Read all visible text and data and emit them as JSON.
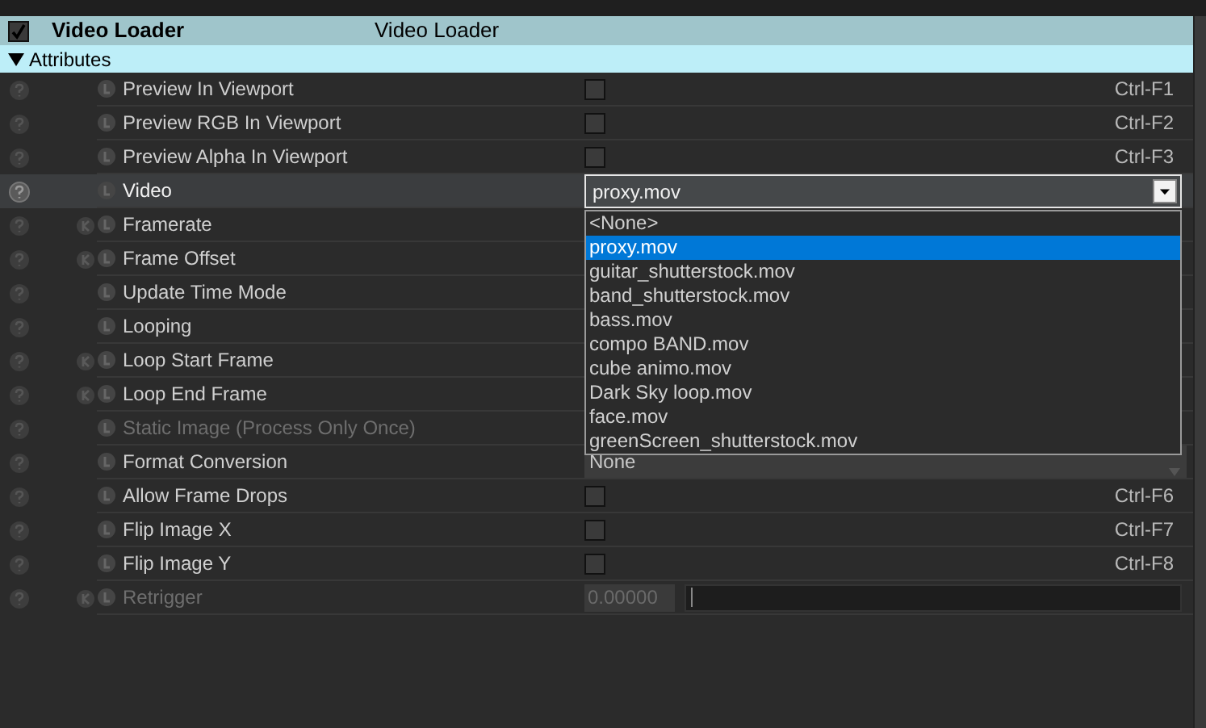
{
  "header": {
    "checked": true,
    "title": "Video Loader",
    "type_name": "Video Loader"
  },
  "section": {
    "label": "Attributes",
    "expanded": true
  },
  "rows": [
    {
      "label": "Preview In Viewport",
      "kind": "checkbox",
      "checked": false,
      "shortcut": "Ctrl-F1",
      "keyable": false,
      "disabled": false,
      "selected": false
    },
    {
      "label": "Preview RGB In Viewport",
      "kind": "checkbox",
      "checked": false,
      "shortcut": "Ctrl-F2",
      "keyable": false,
      "disabled": false,
      "selected": false
    },
    {
      "label": "Preview Alpha In Viewport",
      "kind": "checkbox",
      "checked": false,
      "shortcut": "Ctrl-F3",
      "keyable": false,
      "disabled": false,
      "selected": false
    },
    {
      "label": "Video",
      "kind": "dropdown",
      "value": "proxy.mov",
      "open": true,
      "keyable": false,
      "disabled": false,
      "selected": true
    },
    {
      "label": "Framerate",
      "kind": "covered",
      "keyable": true,
      "disabled": false,
      "selected": false
    },
    {
      "label": "Frame Offset",
      "kind": "covered",
      "keyable": true,
      "disabled": false,
      "selected": false
    },
    {
      "label": "Update Time Mode",
      "kind": "covered",
      "keyable": false,
      "disabled": false,
      "selected": false
    },
    {
      "label": "Looping",
      "kind": "covered",
      "keyable": false,
      "disabled": false,
      "selected": false
    },
    {
      "label": "Loop Start Frame",
      "kind": "covered",
      "keyable": true,
      "disabled": false,
      "selected": false
    },
    {
      "label": "Loop End Frame",
      "kind": "covered",
      "keyable": true,
      "disabled": false,
      "selected": false
    },
    {
      "label": "Static Image (Process Only Once)",
      "kind": "covered",
      "keyable": false,
      "disabled": true,
      "selected": false
    },
    {
      "label": "Format Conversion",
      "kind": "choice",
      "value": "None",
      "keyable": false,
      "disabled": false,
      "selected": false
    },
    {
      "label": "Allow Frame Drops",
      "kind": "checkbox",
      "checked": false,
      "shortcut": "Ctrl-F6",
      "keyable": false,
      "disabled": false,
      "selected": false
    },
    {
      "label": "Flip Image X",
      "kind": "checkbox",
      "checked": false,
      "shortcut": "Ctrl-F7",
      "keyable": false,
      "disabled": false,
      "selected": false
    },
    {
      "label": "Flip Image Y",
      "kind": "checkbox",
      "checked": false,
      "shortcut": "Ctrl-F8",
      "keyable": false,
      "disabled": false,
      "selected": false
    },
    {
      "label": "Retrigger",
      "kind": "number",
      "value": "0.00000",
      "keyable": true,
      "disabled": true,
      "selected": false
    }
  ],
  "video_menu": {
    "items": [
      {
        "label": "<None>",
        "selected": false
      },
      {
        "label": "proxy.mov",
        "selected": true
      },
      {
        "label": "guitar_shutterstock.mov",
        "selected": false
      },
      {
        "label": "band_shutterstock.mov",
        "selected": false
      },
      {
        "label": "bass.mov",
        "selected": false
      },
      {
        "label": "compo BAND.mov",
        "selected": false
      },
      {
        "label": "cube animo.mov",
        "selected": false
      },
      {
        "label": "Dark Sky loop.mov",
        "selected": false
      },
      {
        "label": "face.mov",
        "selected": false
      },
      {
        "label": "greenScreen_shutterstock.mov",
        "selected": false
      }
    ]
  }
}
